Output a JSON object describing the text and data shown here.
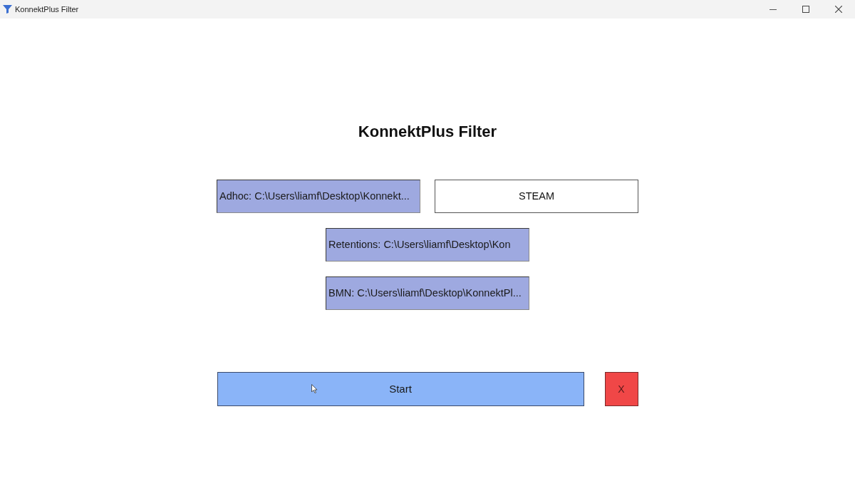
{
  "window": {
    "title": "KonnektPlus Filter"
  },
  "heading": "KonnektPlus Filter",
  "source_rows": [
    [
      {
        "label": "Adhoc: C:\\Users\\liamf\\Desktop\\Konnekt...",
        "kind": "file"
      },
      {
        "label": "STEAM",
        "kind": "plain"
      }
    ],
    [
      {
        "label": "Retentions: C:\\Users\\liamf\\Desktop\\Kon",
        "kind": "file"
      }
    ],
    [
      {
        "label": "BMN: C:\\Users\\liamf\\Desktop\\KonnektPl...",
        "kind": "file"
      }
    ]
  ],
  "actions": [
    {
      "label": "Start",
      "kind": "start"
    },
    {
      "label": "X",
      "kind": "cancel"
    }
  ]
}
